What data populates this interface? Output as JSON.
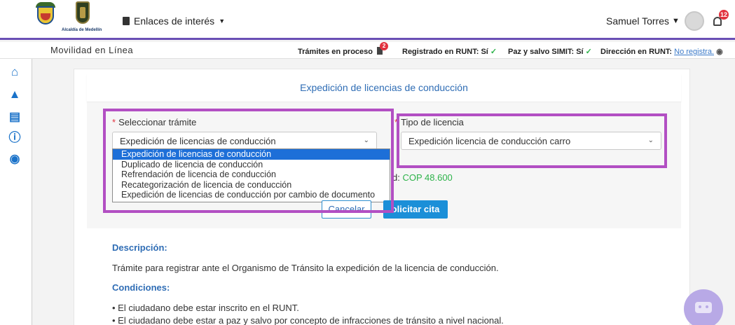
{
  "header": {
    "logo_text": "Alcaldía de Medellín",
    "links_label": "Enlaces de interés",
    "user_name": "Samuel Torres",
    "notification_count": "12"
  },
  "status_bar": {
    "app_name": "Movilidad en Línea",
    "tramites_label": "Trámites en proceso",
    "tramites_count": "2",
    "runt_label": "Registrado en RUNT: Sí",
    "simit_label": "Paz y salvo SIMIT: Sí",
    "direccion_label": "Dirección en RUNT:",
    "direccion_value": "No registra."
  },
  "card": {
    "title": "Expedición de licencias de conducción",
    "tramite_label": "Seleccionar trámite",
    "tramite_value": "Expedición de licencias de conducción",
    "tramite_options": [
      "Expedición de licencias de conducción",
      "Duplicado de licencia de conducción",
      "Refrendación de licencia de conducción",
      "Recategorización de licencia de conducción",
      "Expedición de licencias de conducción por cambio de documento"
    ],
    "tipo_label": "Tipo de licencia",
    "tipo_value": "Expedición licencia de conducción carro",
    "cost_prefix": "d:",
    "cost_value": "COP 48.600",
    "cancel_label": "Cancelar",
    "submit_label": "olicitar cita"
  },
  "info": {
    "desc_title": "Descripción:",
    "desc_text": "Trámite para registrar ante el Organismo de Tránsito la expedición de la licencia de conducción.",
    "cond_title": "Condiciones:",
    "conditions": [
      "• El ciudadano debe estar inscrito en el RUNT.",
      "• El ciudadano debe estar a paz y salvo por concepto de infracciones de tránsito a nivel nacional."
    ]
  },
  "colors": {
    "accent": "#2f6db5",
    "highlight": "#b24fc3",
    "selected": "#1d6fd8",
    "success": "#2db34a"
  }
}
